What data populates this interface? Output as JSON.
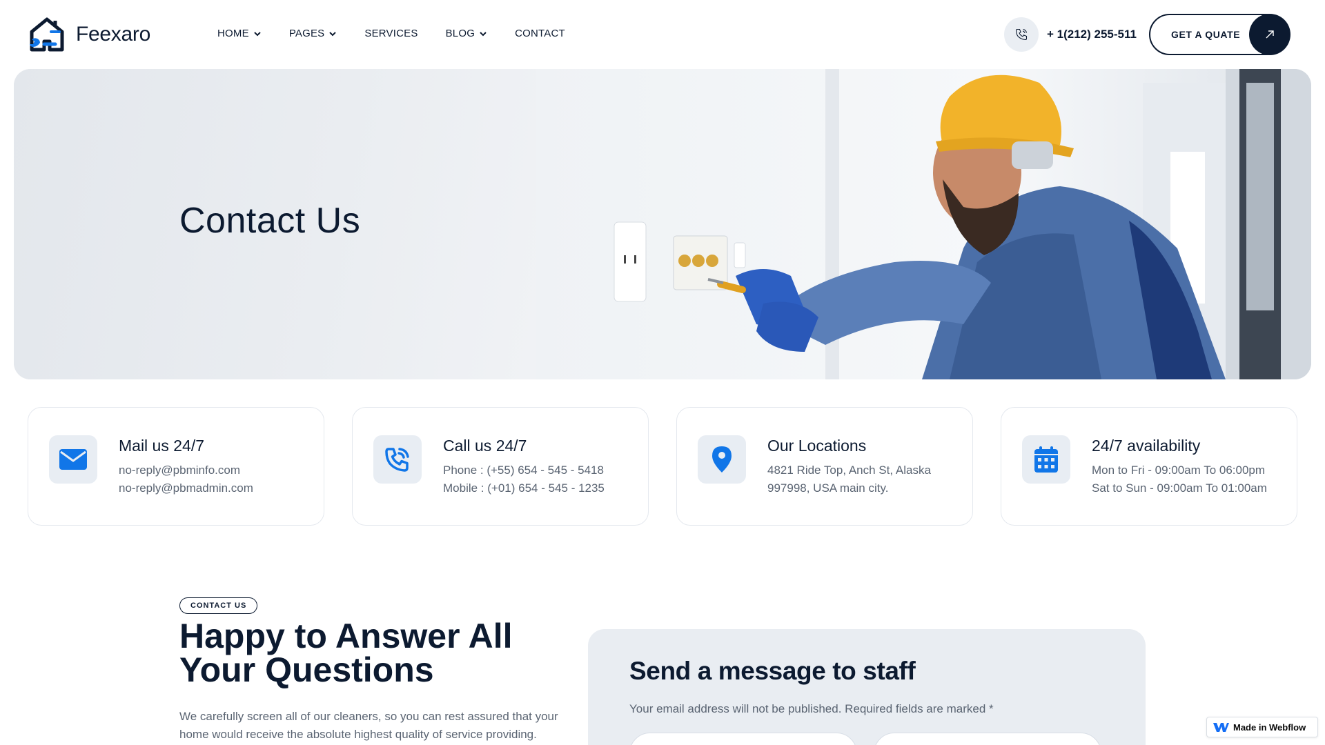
{
  "brand": {
    "name": "Feexaro",
    "accent": "#1176e8",
    "dark": "#0c1a30"
  },
  "nav": {
    "items": [
      {
        "label": "HOME",
        "dropdown": true
      },
      {
        "label": "PAGES",
        "dropdown": true
      },
      {
        "label": "SERVICES",
        "dropdown": false
      },
      {
        "label": "BLOG",
        "dropdown": true
      },
      {
        "label": "CONTACT",
        "dropdown": false
      }
    ]
  },
  "header": {
    "phone": "+ 1(212) 255-511",
    "quote_label": "GET A QUATE"
  },
  "hero": {
    "title": "Contact Us"
  },
  "cards": [
    {
      "icon": "mail-icon",
      "title": "Mail us 24/7",
      "line1": "no-reply@pbminfo.com",
      "line2": "no-reply@pbmadmin.com"
    },
    {
      "icon": "phone-call-icon",
      "title": "Call us 24/7",
      "line1": "Phone : (+55) 654 - 545 - 5418",
      "line2": "Mobile : (+01) 654 - 545 - 1235"
    },
    {
      "icon": "location-pin-icon",
      "title": "Our Locations",
      "line1": "4821 Ride Top, Anch St, Alaska",
      "line2": "997998, USA main city."
    },
    {
      "icon": "calendar-icon",
      "title": "24/7 availability",
      "line1": "Mon to Fri - 09:00am To 06:00pm",
      "line2": "Sat to Sun - 09:00am To 01:00am"
    }
  ],
  "contact_section": {
    "tag": "CONTACT US",
    "heading": "Happy to Answer All Your Questions",
    "body": "We carefully screen all of our cleaners, so you can rest assured that your home would receive the absolute highest quality of service providing."
  },
  "form": {
    "title": "Send a message to staff",
    "subtitle": "Your email address will not be published. Required fields are marked *"
  },
  "badge": {
    "label": "Made in Webflow"
  }
}
